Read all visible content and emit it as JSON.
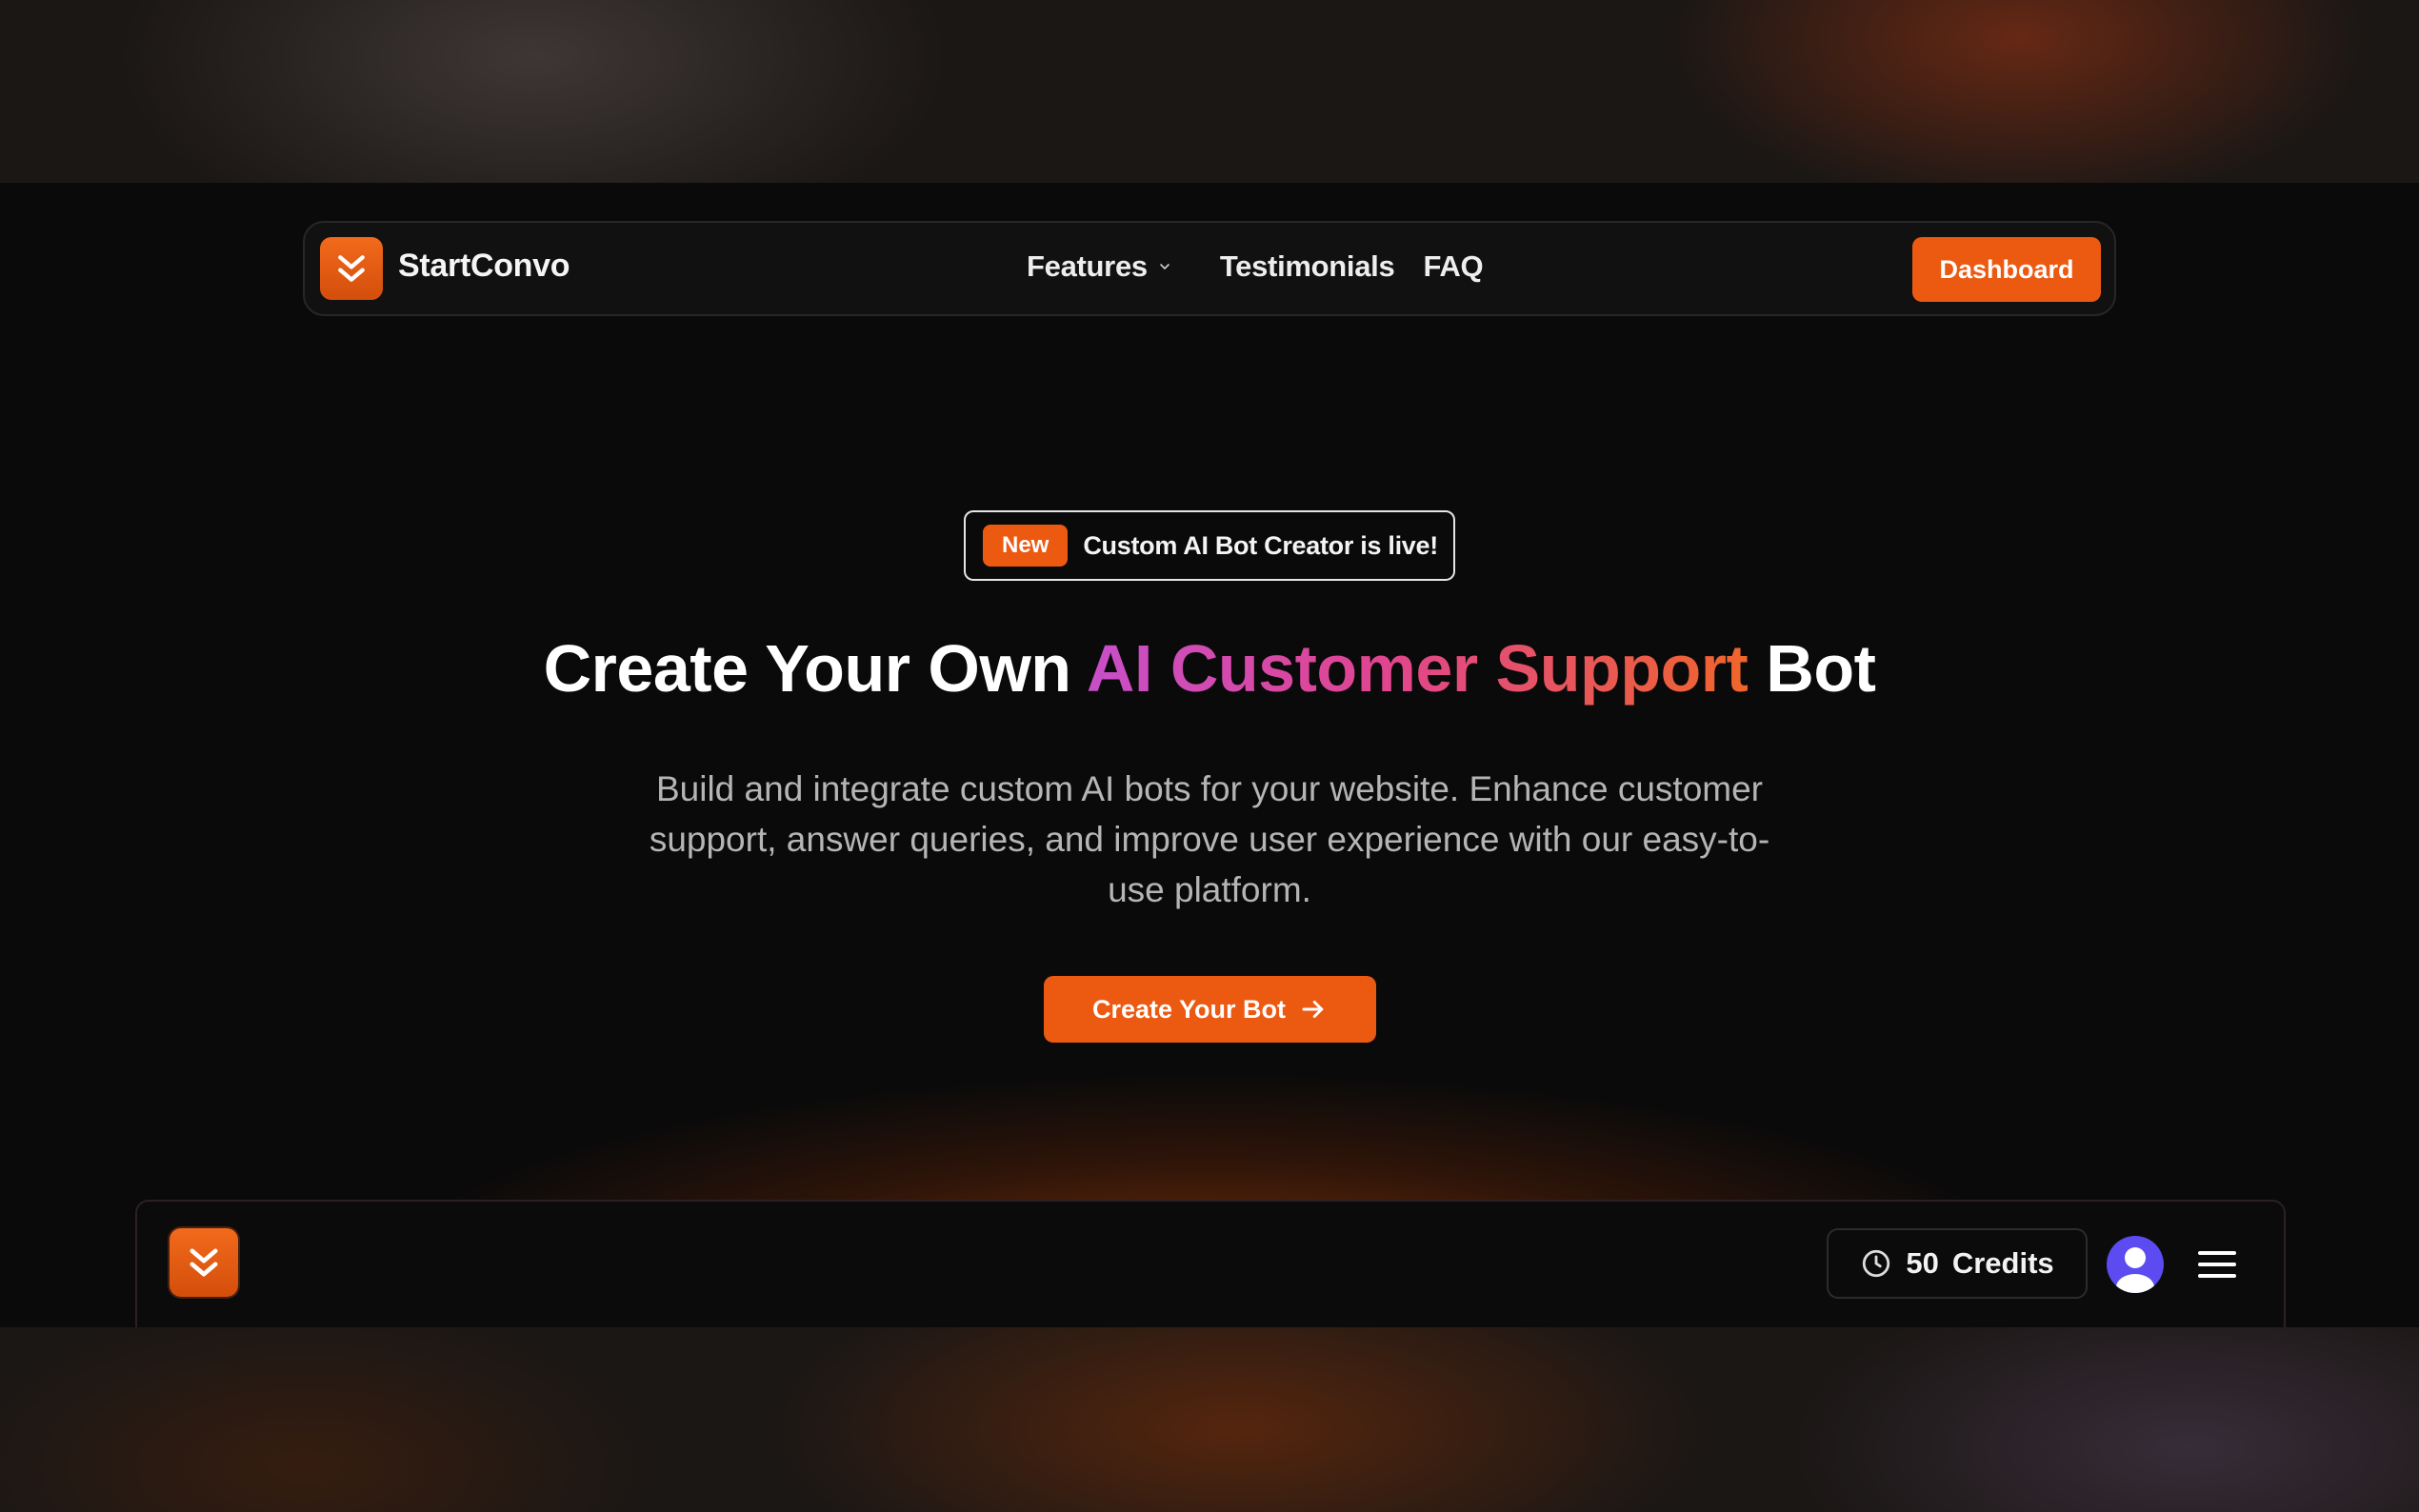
{
  "nav": {
    "brand": "StartConvo",
    "links": [
      {
        "label": "Features"
      },
      {
        "label": "Testimonials"
      },
      {
        "label": "FAQ"
      }
    ],
    "dashboard_label": "Dashboard"
  },
  "hero": {
    "badge_tag": "New",
    "badge_text": "Custom AI Bot Creator is live!",
    "headline_start": "Create Your Own ",
    "headline_highlight": "AI Customer Support",
    "headline_end": " Bot",
    "description": "Build and integrate custom AI bots for your website. Enhance customer support, answer queries, and improve user experience with our easy-to-use platform.",
    "cta_label": "Create Your Bot"
  },
  "appbar": {
    "credits_value": "50",
    "credits_label": "Credits"
  },
  "colors": {
    "accent": "#ec5a12",
    "gradient_start": "#c84fc9",
    "gradient_end": "#f0652b"
  },
  "icons": {
    "logo": "double-chevron-down-icon",
    "features_dropdown": "chevron-down-icon",
    "cta": "arrow-right-icon",
    "credits": "clock-icon",
    "avatar": "user-avatar-icon",
    "menu": "hamburger-menu-icon"
  }
}
